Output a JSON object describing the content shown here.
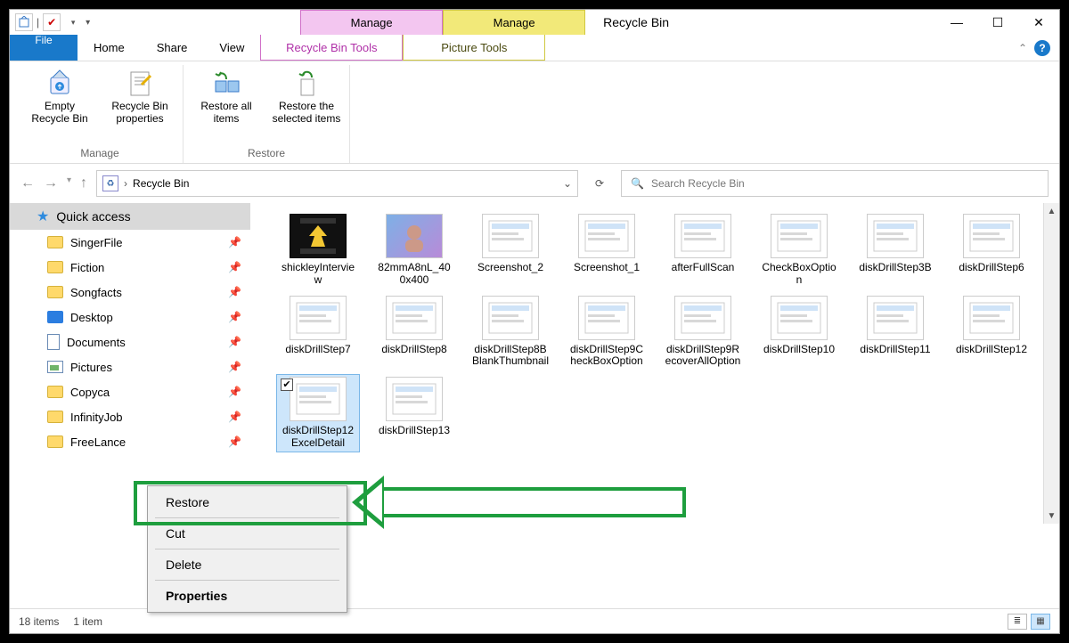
{
  "window": {
    "title": "Recycle Bin",
    "context_tabs": [
      "Manage",
      "Manage"
    ],
    "controls": {
      "min": "—",
      "max": "☐",
      "close": "✕"
    }
  },
  "tabs": {
    "file": "File",
    "home": "Home",
    "share": "Share",
    "view": "View",
    "recycle_tools": "Recycle Bin Tools",
    "picture_tools": "Picture Tools"
  },
  "ribbon": {
    "group_manage": "Manage",
    "group_restore": "Restore",
    "empty": "Empty Recycle Bin",
    "props": "Recycle Bin properties",
    "restore_all": "Restore all items",
    "restore_sel": "Restore the selected items"
  },
  "nav": {
    "location": "Recycle Bin",
    "search_placeholder": "Search Recycle Bin"
  },
  "sidebar": {
    "quick": "Quick access",
    "items": [
      {
        "label": "SingerFile"
      },
      {
        "label": "Fiction"
      },
      {
        "label": "Songfacts"
      },
      {
        "label": "Desktop"
      },
      {
        "label": "Documents"
      },
      {
        "label": "Pictures"
      },
      {
        "label": "Copyca"
      },
      {
        "label": "InfinityJob"
      },
      {
        "label": "FreeLance"
      }
    ]
  },
  "files": [
    {
      "label": "shickleyInterview",
      "kind": "movie"
    },
    {
      "label": "82mmA8nL_400x400",
      "kind": "photo"
    },
    {
      "label": "Screenshot_2",
      "kind": "image"
    },
    {
      "label": "Screenshot_1",
      "kind": "image"
    },
    {
      "label": "afterFullScan",
      "kind": "image"
    },
    {
      "label": "CheckBoxOption",
      "kind": "image"
    },
    {
      "label": "diskDrillStep3B",
      "kind": "image"
    },
    {
      "label": "diskDrillStep6",
      "kind": "image"
    },
    {
      "label": "diskDrillStep7",
      "kind": "image"
    },
    {
      "label": "diskDrillStep8",
      "kind": "image"
    },
    {
      "label": "diskDrillStep8BBlankThumbnail",
      "kind": "image"
    },
    {
      "label": "diskDrillStep9CheckBoxOption",
      "kind": "image"
    },
    {
      "label": "diskDrillStep9RecoverAllOption",
      "kind": "image"
    },
    {
      "label": "diskDrillStep10",
      "kind": "image"
    },
    {
      "label": "diskDrillStep11",
      "kind": "image"
    },
    {
      "label": "diskDrillStep12",
      "kind": "image"
    },
    {
      "label": "diskDrillStep12ExcelDetail",
      "kind": "image",
      "selected": true
    },
    {
      "label": "diskDrillStep13",
      "kind": "image"
    }
  ],
  "context_menu": {
    "restore": "Restore",
    "cut": "Cut",
    "delete": "Delete",
    "properties": "Properties"
  },
  "status": {
    "total": "18 items",
    "selected": "1 item"
  }
}
